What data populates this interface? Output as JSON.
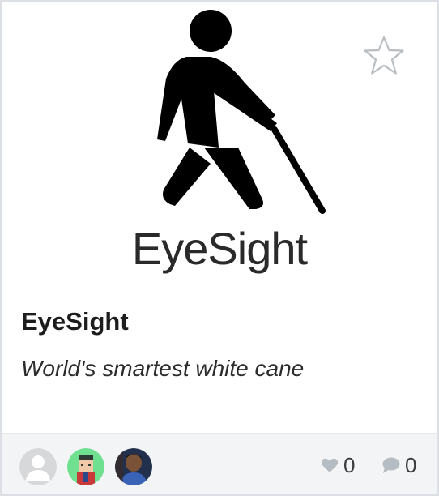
{
  "project": {
    "cover_logo_text": "EyeSight",
    "title": "EyeSight",
    "tagline": "World's smartest white cane"
  },
  "icons": {
    "cover": "walking-person-with-cane-icon",
    "favorite": "star-outline-icon",
    "likes": "heart-icon",
    "comments": "speech-bubble-icon"
  },
  "members": [
    {
      "avatar": "default-user-avatar"
    },
    {
      "avatar": "illustrated-character-avatar"
    },
    {
      "avatar": "photo-avatar"
    }
  ],
  "stats": {
    "likes": "0",
    "comments": "0"
  },
  "colors": {
    "footer_bg": "#f2f4f5",
    "border": "#dcdfe3",
    "icon_gray": "#b5bcc2",
    "avatar_green": "#6ee08f"
  }
}
